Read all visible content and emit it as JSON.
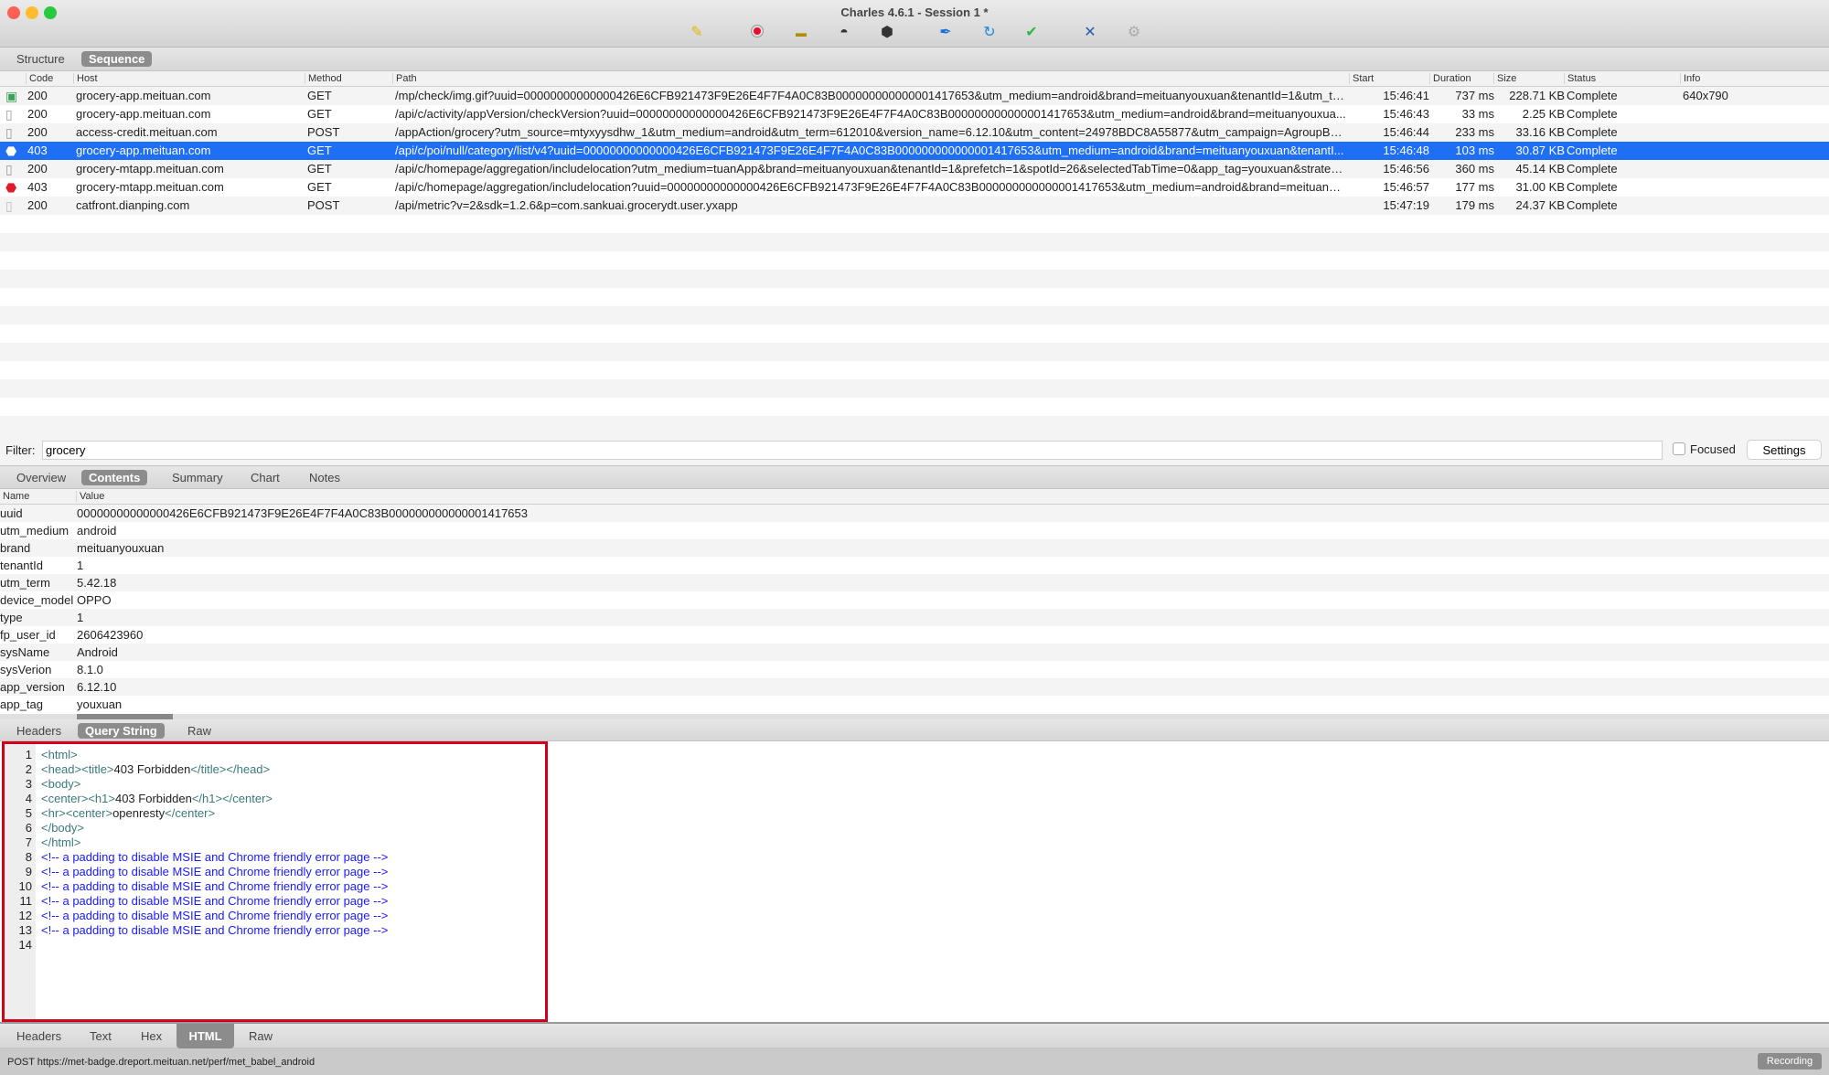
{
  "window": {
    "title": "Charles 4.6.1 - Session 1 *",
    "traffic_colors": [
      "#fe5f57",
      "#febc2e",
      "#28c840"
    ]
  },
  "toolbar": {
    "icons": [
      "broom-icon",
      "record-icon",
      "ssl-lock-icon",
      "throttle-icon",
      "breakpoint-icon",
      "compose-pen-icon",
      "repeat-icon",
      "validate-check-icon",
      "tools-icon",
      "settings-gear-icon"
    ]
  },
  "view_tabs": [
    {
      "label": "Structure"
    },
    {
      "label": "Sequence",
      "selected": true
    }
  ],
  "table": {
    "columns": [
      "Code",
      "Host",
      "Method",
      "Path",
      "Start",
      "Duration",
      "Size",
      "Status",
      "Info"
    ],
    "rows": [
      {
        "icon": "image-file-icon",
        "code": "200",
        "host": "grocery-app.meituan.com",
        "method": "GET",
        "path": "/mp/check/img.gif?uuid=00000000000000426E6CFB921473F9E26E4F7F4A0C83B000000000000001417653&utm_medium=android&brand=meituanyouxuan&tenantId=1&utm_ter...",
        "start": "15:46:41",
        "duration": "737 ms",
        "size": "228.71 KB",
        "status": "Complete",
        "info": "640x790"
      },
      {
        "icon": "json-file-icon",
        "code": "200",
        "host": "grocery-app.meituan.com",
        "method": "GET",
        "path": "/api/c/activity/appVersion/checkVersion?uuid=00000000000000426E6CFB921473F9E26E4F7F4A0C83B000000000000001417653&utm_medium=android&brand=meituanyouxua...",
        "start": "15:46:43",
        "duration": "33 ms",
        "size": "2.25 KB",
        "status": "Complete",
        "info": ""
      },
      {
        "icon": "json-file-icon",
        "code": "200",
        "host": "access-credit.meituan.com",
        "method": "POST",
        "path": "/appAction/grocery?utm_source=mtyxyysdhw_1&utm_medium=android&utm_term=612010&version_name=6.12.10&utm_content=24978BDC8A55877&utm_campaign=AgroupBgr...",
        "start": "15:46:44",
        "duration": "233 ms",
        "size": "33.16 KB",
        "status": "Complete",
        "info": ""
      },
      {
        "icon": "error-stop-icon",
        "code": "403",
        "host": "grocery-app.meituan.com",
        "method": "GET",
        "path": "/api/c/poi/null/category/list/v4?uuid=00000000000000426E6CFB921473F9E26E4F7F4A0C83B000000000000001417653&utm_medium=android&brand=meituanyouxuan&tenantI...",
        "start": "15:46:48",
        "duration": "103 ms",
        "size": "30.87 KB",
        "status": "Complete",
        "info": "",
        "selected": true
      },
      {
        "icon": "json-file-icon",
        "code": "200",
        "host": "grocery-mtapp.meituan.com",
        "method": "GET",
        "path": "/api/c/homepage/aggregation/includelocation?utm_medium=tuanApp&brand=meituanyouxuan&tenantId=1&prefetch=1&spotId=26&selectedTabTime=0&app_tag=youxuan&strategy...",
        "start": "15:46:56",
        "duration": "360 ms",
        "size": "45.14 KB",
        "status": "Complete",
        "info": ""
      },
      {
        "icon": "error-stop-icon",
        "code": "403",
        "host": "grocery-mtapp.meituan.com",
        "method": "GET",
        "path": "/api/c/homepage/aggregation/includelocation?uuid=00000000000000426E6CFB921473F9E26E4F7F4A0C83B000000000000001417653&utm_medium=android&brand=meituanyo...",
        "start": "15:46:57",
        "duration": "177 ms",
        "size": "31.00 KB",
        "status": "Complete",
        "info": ""
      },
      {
        "icon": "blank-file-icon",
        "code": "200",
        "host": "catfront.dianping.com",
        "method": "POST",
        "path": "/api/metric?v=2&sdk=1.2.6&p=com.sankuai.grocerydt.user.yxapp",
        "start": "15:47:19",
        "duration": "179 ms",
        "size": "24.37 KB",
        "status": "Complete",
        "info": ""
      }
    ]
  },
  "filter": {
    "label": "Filter:",
    "value": "grocery",
    "focused_label": "Focused",
    "focused_checked": false,
    "settings_label": "Settings"
  },
  "detail_tabs": [
    {
      "label": "Overview"
    },
    {
      "label": "Contents",
      "selected": true
    },
    {
      "label": "Summary"
    },
    {
      "label": "Chart"
    },
    {
      "label": "Notes"
    }
  ],
  "params": {
    "columns": [
      "Name",
      "Value"
    ],
    "rows": [
      {
        "name": "uuid",
        "value": "00000000000000426E6CFB921473F9E26E4F7F4A0C83B000000000000001417653"
      },
      {
        "name": "utm_medium",
        "value": "android"
      },
      {
        "name": "brand",
        "value": "meituanyouxuan"
      },
      {
        "name": "tenantId",
        "value": "1"
      },
      {
        "name": "utm_term",
        "value": "5.42.18"
      },
      {
        "name": "device_model",
        "value": "OPPO"
      },
      {
        "name": "type",
        "value": "1"
      },
      {
        "name": "fp_user_id",
        "value": "2606423960"
      },
      {
        "name": "sysName",
        "value": "Android"
      },
      {
        "name": "sysVerion",
        "value": "8.1.0"
      },
      {
        "name": "app_version",
        "value": "6.12.10"
      },
      {
        "name": "app_tag",
        "value": "youxuan"
      }
    ]
  },
  "request_tabs": [
    {
      "label": "Headers"
    },
    {
      "label": "Query String",
      "selected": true
    },
    {
      "label": "Raw"
    }
  ],
  "code": {
    "lines": [
      [
        [
          "t",
          "<html>"
        ]
      ],
      [
        [
          "t",
          "<head><title>"
        ],
        [
          "x",
          "403 Forbidden"
        ],
        [
          "t",
          "</title></head>"
        ]
      ],
      [
        [
          "t",
          "<body>"
        ]
      ],
      [
        [
          "t",
          "<center><h1>"
        ],
        [
          "x",
          "403 Forbidden"
        ],
        [
          "t",
          "</h1></center>"
        ]
      ],
      [
        [
          "t",
          "<hr><center>"
        ],
        [
          "x",
          "openresty"
        ],
        [
          "t",
          "</center>"
        ]
      ],
      [
        [
          "t",
          "</body>"
        ]
      ],
      [
        [
          "t",
          "</html>"
        ]
      ],
      [
        [
          "c",
          "<!-- a padding to disable MSIE and Chrome friendly error page -->"
        ]
      ],
      [
        [
          "c",
          "<!-- a padding to disable MSIE and Chrome friendly error page -->"
        ]
      ],
      [
        [
          "c",
          "<!-- a padding to disable MSIE and Chrome friendly error page -->"
        ]
      ],
      [
        [
          "c",
          "<!-- a padding to disable MSIE and Chrome friendly error page -->"
        ]
      ],
      [
        [
          "c",
          "<!-- a padding to disable MSIE and Chrome friendly error page -->"
        ]
      ],
      [
        [
          "c",
          "<!-- a padding to disable MSIE and Chrome friendly error page -->"
        ]
      ],
      []
    ],
    "highlight_color": "#d0021b"
  },
  "response_tabs": [
    {
      "label": "Headers"
    },
    {
      "label": "Text"
    },
    {
      "label": "Hex"
    },
    {
      "label": "HTML",
      "selected": true
    },
    {
      "label": "Raw"
    }
  ],
  "statusbar": {
    "text": "POST https://met-badge.dreport.meituan.net/perf/met_babel_android",
    "recording_label": "Recording"
  },
  "colors": {
    "selection": "#1f6ff5",
    "accent_red": "#d0021b"
  }
}
